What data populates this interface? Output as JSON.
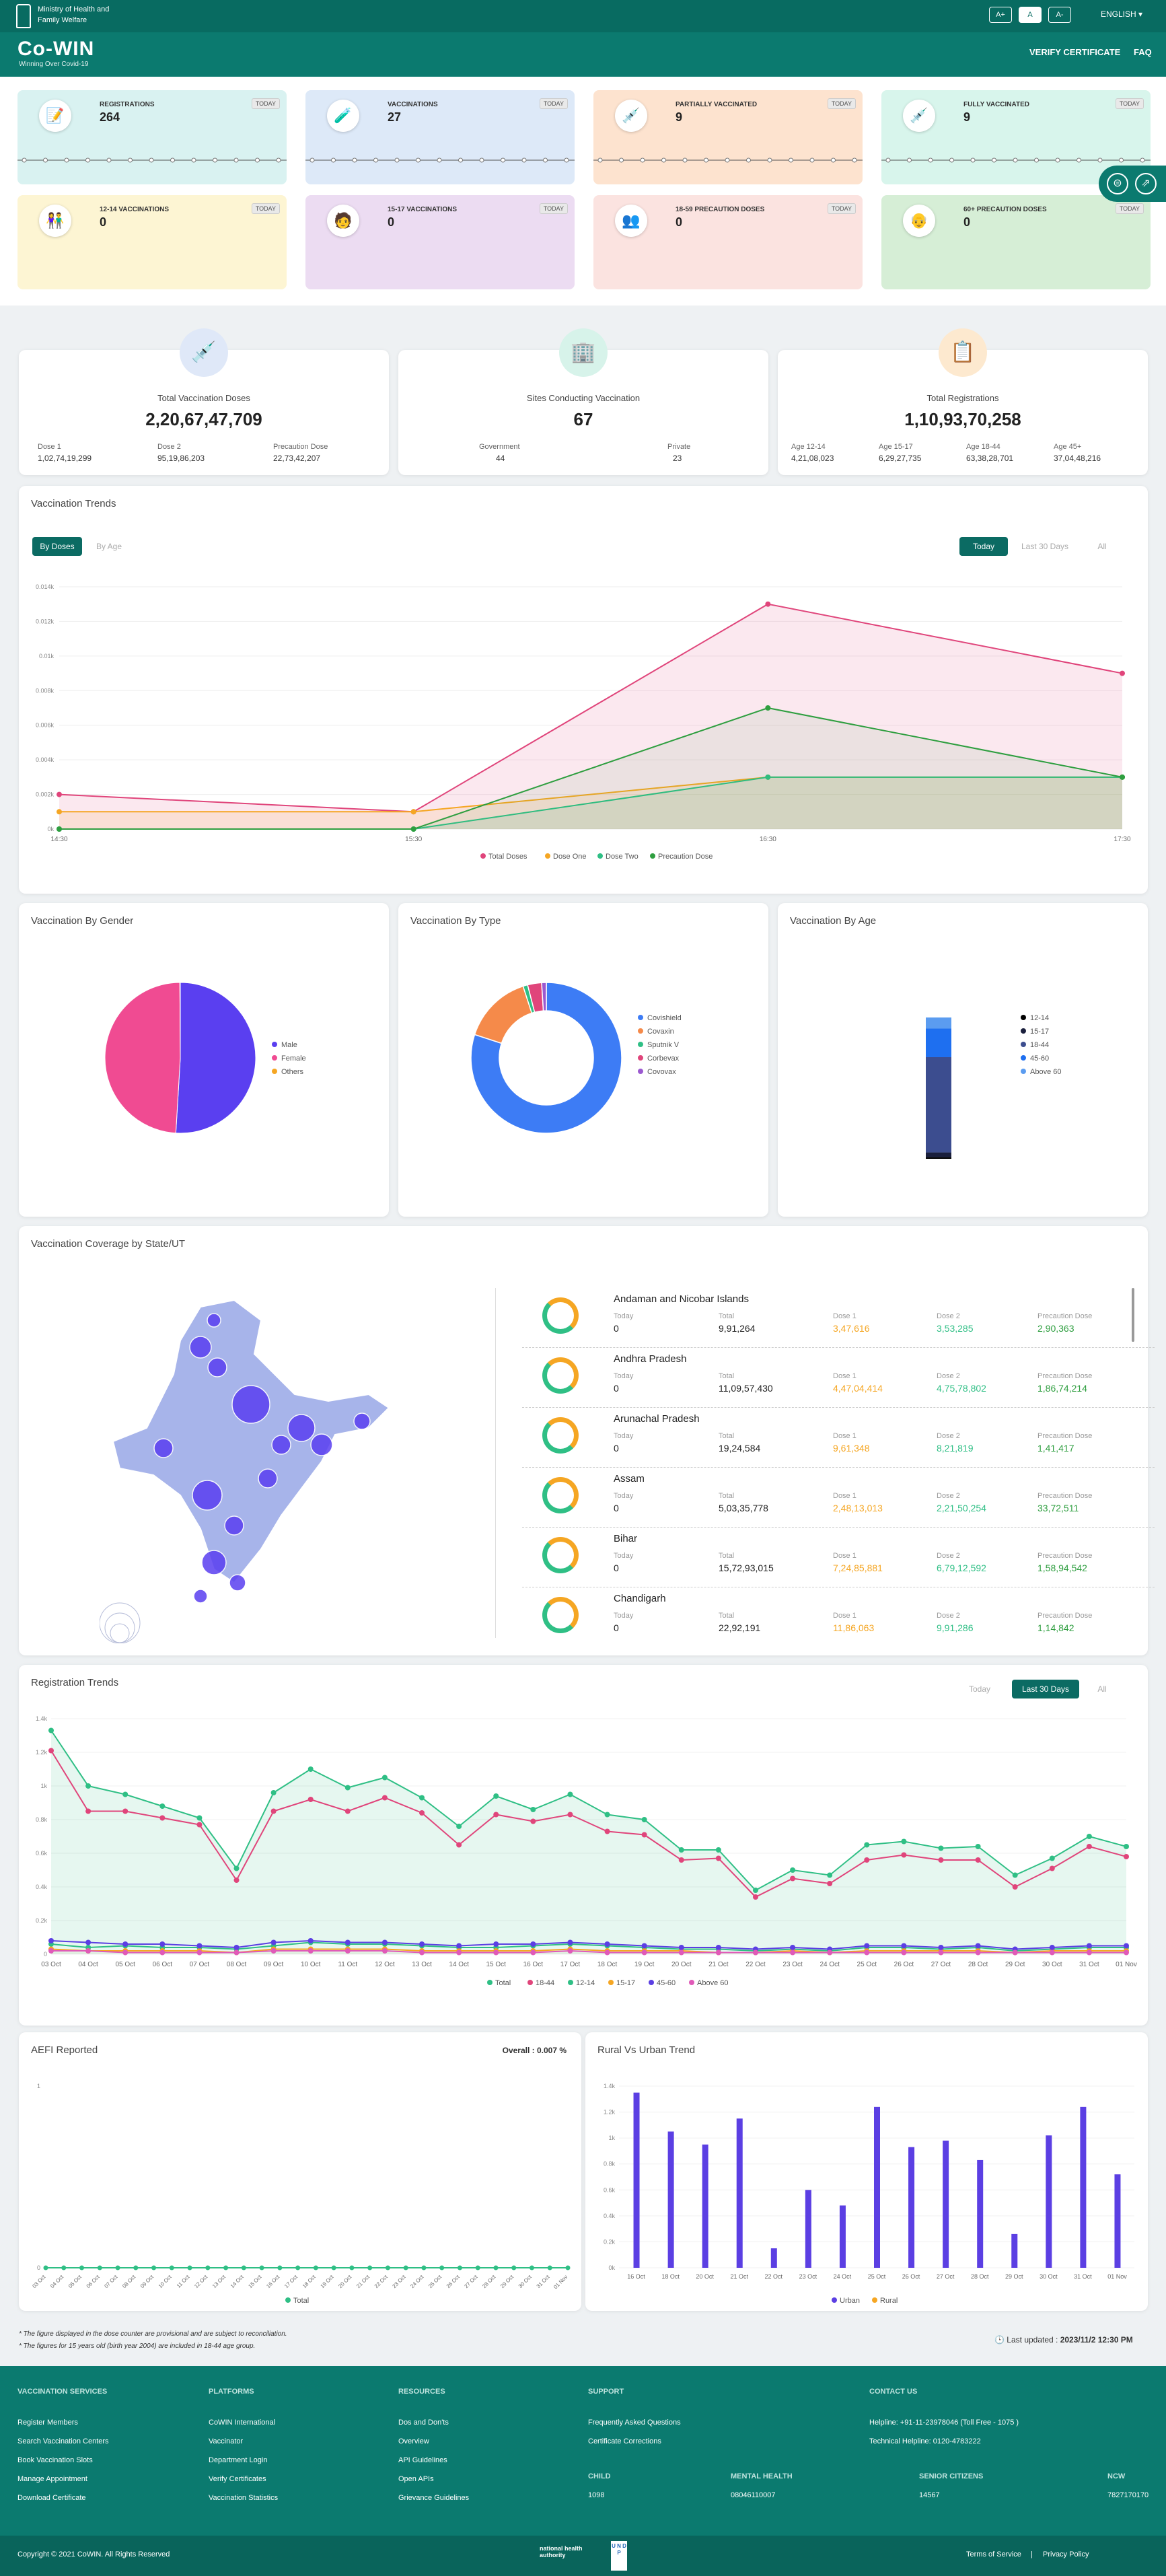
{
  "header": {
    "ministry": "Ministry of Health and Family Welfare",
    "font_buttons": [
      "A+",
      "A",
      "A-"
    ],
    "language": "ENGLISH",
    "logo": "Co-WIN",
    "tagline": "Winning Over Covid-19",
    "nav": [
      "VERIFY CERTIFICATE",
      "FAQ"
    ]
  },
  "today_cards": [
    {
      "label": "REGISTRATIONS",
      "value": "264",
      "badge": "TODAY",
      "bg": "#d9f2f1",
      "icon": "registration-icon"
    },
    {
      "label": "VACCINATIONS",
      "value": "27",
      "badge": "TODAY",
      "bg": "#dde9f8",
      "icon": "vaccine-vial-icon"
    },
    {
      "label": "PARTIALLY VACCINATED",
      "value": "9",
      "badge": "TODAY",
      "bg": "#fde3cf",
      "icon": "partial-vaccinated-icon"
    },
    {
      "label": "FULLY VACCINATED",
      "value": "9",
      "badge": "TODAY",
      "bg": "#d8f5ec",
      "icon": "fully-vaccinated-icon"
    },
    {
      "label": "12-14 VACCINATIONS",
      "value": "0",
      "badge": "TODAY",
      "bg": "#fdf5d3",
      "icon": "children-icon"
    },
    {
      "label": "15-17 VACCINATIONS",
      "value": "0",
      "badge": "TODAY",
      "bg": "#ecdcf2",
      "icon": "teen-icon"
    },
    {
      "label": "18-59 PRECAUTION DOSES",
      "value": "0",
      "badge": "TODAY",
      "bg": "#fbe3e0",
      "icon": "adult-icon"
    },
    {
      "label": "60+ PRECAUTION DOSES",
      "value": "0",
      "badge": "TODAY",
      "bg": "#d6eed6",
      "icon": "senior-icon"
    }
  ],
  "totals": {
    "doses": {
      "title": "Total Vaccination Doses",
      "value": "2,20,67,47,709",
      "subs": [
        {
          "label": "Dose 1",
          "value": "1,02,74,19,299"
        },
        {
          "label": "Dose 2",
          "value": "95,19,86,203"
        },
        {
          "label": "Precaution Dose",
          "value": "22,73,42,207"
        }
      ]
    },
    "sites": {
      "title": "Sites Conducting Vaccination",
      "value": "67",
      "subs": [
        {
          "label": "Government",
          "value": "44"
        },
        {
          "label": "Private",
          "value": "23"
        }
      ]
    },
    "registrations": {
      "title": "Total Registrations",
      "value": "1,10,93,70,258",
      "subs": [
        {
          "label": "Age 12-14",
          "value": "4,21,08,023"
        },
        {
          "label": "Age 15-17",
          "value": "6,29,27,735"
        },
        {
          "label": "Age 18-44",
          "value": "63,38,28,701"
        },
        {
          "label": "Age 45+",
          "value": "37,04,48,216"
        }
      ]
    }
  },
  "trends": {
    "title": "Vaccination Trends",
    "tabs": [
      "By Doses",
      "By Age"
    ],
    "time_tabs": [
      "Today",
      "Last 30 Days",
      "All"
    ]
  },
  "chart_data": [
    {
      "type": "area",
      "categories": [
        "14:30",
        "15:30",
        "16:30",
        "17:30"
      ],
      "y_ticks": [
        "0k",
        "0.002k",
        "0.004k",
        "0.006k",
        "0.008k",
        "0.01k",
        "0.012k",
        "0.014k"
      ],
      "ylim": [
        0,
        14
      ],
      "series": [
        {
          "name": "Total Doses",
          "values": [
            2,
            1,
            13,
            9
          ]
        },
        {
          "name": "Dose One",
          "values": [
            1,
            1,
            3,
            3
          ]
        },
        {
          "name": "Dose Two",
          "values": [
            0,
            0,
            3,
            3
          ]
        },
        {
          "name": "Precaution Dose",
          "values": [
            0,
            0,
            7,
            3
          ]
        }
      ]
    },
    {
      "type": "pie",
      "title": "Vaccination By Gender",
      "labels": [
        "Male",
        "Female",
        "Others"
      ],
      "values": [
        51,
        49,
        0.1
      ]
    },
    {
      "type": "pie",
      "title": "Vaccination By Type",
      "labels": [
        "Covishield",
        "Covaxin",
        "Sputnik V",
        "Corbevax",
        "Covovax"
      ],
      "values": [
        80,
        15,
        1,
        3,
        1
      ]
    },
    {
      "type": "bar",
      "title": "Vaccination By Age",
      "labels": [
        "12-14",
        "15-17",
        "18-44",
        "45-60",
        "Above 60"
      ],
      "values": [
        1,
        3,
        60,
        18,
        7
      ]
    },
    {
      "type": "area",
      "title": "Registration Trends",
      "categories": [
        "03 Oct",
        "04 Oct",
        "05 Oct",
        "06 Oct",
        "07 Oct",
        "08 Oct",
        "09 Oct",
        "10 Oct",
        "11 Oct",
        "12 Oct",
        "13 Oct",
        "14 Oct",
        "15 Oct",
        "16 Oct",
        "17 Oct",
        "18 Oct",
        "19 Oct",
        "20 Oct",
        "21 Oct",
        "22 Oct",
        "23 Oct",
        "24 Oct",
        "25 Oct",
        "26 Oct",
        "27 Oct",
        "28 Oct",
        "29 Oct",
        "30 Oct",
        "31 Oct",
        "01 Nov"
      ],
      "y_ticks": [
        "0",
        "0.2k",
        "0.4k",
        "0.6k",
        "0.8k",
        "1k",
        "1.2k",
        "1.4k"
      ],
      "ylim": [
        0,
        1400
      ],
      "series": [
        {
          "name": "Total",
          "values": [
            1330,
            1000,
            950,
            880,
            810,
            510,
            960,
            1100,
            990,
            1050,
            930,
            760,
            940,
            860,
            950,
            830,
            800,
            620,
            620,
            380,
            500,
            470,
            650,
            670,
            630,
            640,
            470,
            570,
            700,
            640
          ]
        },
        {
          "name": "18-44",
          "values": [
            1210,
            850,
            850,
            810,
            770,
            440,
            850,
            920,
            850,
            930,
            840,
            650,
            830,
            790,
            830,
            730,
            710,
            560,
            570,
            340,
            450,
            420,
            560,
            590,
            560,
            560,
            400,
            510,
            640,
            580
          ]
        },
        {
          "name": "12-14",
          "values": [
            60,
            40,
            50,
            40,
            40,
            30,
            50,
            70,
            60,
            60,
            50,
            40,
            40,
            50,
            60,
            50,
            40,
            30,
            30,
            20,
            30,
            20,
            40,
            40,
            30,
            40,
            20,
            30,
            40,
            40
          ]
        },
        {
          "name": "15-17",
          "values": [
            30,
            20,
            20,
            20,
            20,
            10,
            30,
            30,
            30,
            30,
            20,
            20,
            20,
            20,
            30,
            20,
            20,
            20,
            10,
            10,
            20,
            10,
            20,
            20,
            20,
            20,
            10,
            20,
            20,
            20
          ]
        },
        {
          "name": "45-60",
          "values": [
            80,
            70,
            60,
            60,
            50,
            40,
            70,
            80,
            70,
            70,
            60,
            50,
            60,
            60,
            70,
            60,
            50,
            40,
            40,
            30,
            40,
            30,
            50,
            50,
            40,
            50,
            30,
            40,
            50,
            50
          ]
        },
        {
          "name": "Above 60",
          "values": [
            20,
            20,
            10,
            10,
            10,
            10,
            20,
            20,
            20,
            20,
            10,
            10,
            10,
            10,
            20,
            10,
            10,
            10,
            10,
            10,
            10,
            10,
            10,
            10,
            10,
            10,
            10,
            10,
            10,
            10
          ]
        }
      ]
    },
    {
      "type": "line",
      "title": "AEFI Reported",
      "categories": [
        "03 Oct",
        "04 Oct",
        "05 Oct",
        "06 Oct",
        "07 Oct",
        "08 Oct",
        "09 Oct",
        "10 Oct",
        "11 Oct",
        "12 Oct",
        "13 Oct",
        "14 Oct",
        "15 Oct",
        "16 Oct",
        "17 Oct",
        "18 Oct",
        "19 Oct",
        "20 Oct",
        "21 Oct",
        "22 Oct",
        "23 Oct",
        "24 Oct",
        "25 Oct",
        "26 Oct",
        "27 Oct",
        "28 Oct",
        "29 Oct",
        "30 Oct",
        "31 Oct",
        "01 Nov"
      ],
      "y_ticks": [
        "0",
        "1"
      ],
      "series": [
        {
          "name": "Total",
          "values": [
            0,
            0,
            0,
            0,
            0,
            0,
            0,
            0,
            0,
            0,
            0,
            0,
            0,
            0,
            0,
            0,
            0,
            0,
            0,
            0,
            0,
            0,
            0,
            0,
            0,
            0,
            0,
            0,
            0,
            0
          ]
        }
      ]
    },
    {
      "type": "bar",
      "title": "Rural Vs Urban Trend",
      "categories": [
        "16 Oct",
        "18 Oct",
        "20 Oct",
        "21 Oct",
        "22 Oct",
        "23 Oct",
        "24 Oct",
        "25 Oct",
        "26 Oct",
        "27 Oct",
        "28 Oct",
        "29 Oct",
        "30 Oct",
        "31 Oct",
        "01 Nov"
      ],
      "y_ticks": [
        "0k",
        "0.2k",
        "0.4k",
        "0.6k",
        "0.8k",
        "1k",
        "1.2k",
        "1.4k"
      ],
      "series": [
        {
          "name": "Urban",
          "values": [
            1.35,
            1.05,
            0.95,
            1.15,
            0.15,
            0.6,
            0.48,
            1.24,
            0.93,
            0.98,
            0.83,
            0.26,
            1.02,
            1.24,
            0.72
          ]
        },
        {
          "name": "Rural",
          "values": [
            0,
            0,
            0,
            0,
            0,
            0,
            0,
            0,
            0,
            0,
            0,
            0,
            0,
            0,
            0
          ]
        }
      ]
    }
  ],
  "coverage": {
    "title": "Vaccination Coverage by State/UT",
    "headers": [
      "Today",
      "Total",
      "Dose 1",
      "Dose 2",
      "Precaution Dose"
    ],
    "states": [
      {
        "name": "Andaman and Nicobar Islands",
        "today": "0",
        "total": "9,91,264",
        "d1": "3,47,616",
        "d2": "3,53,285",
        "p": "2,90,363"
      },
      {
        "name": "Andhra Pradesh",
        "today": "0",
        "total": "11,09,57,430",
        "d1": "4,47,04,414",
        "d2": "4,75,78,802",
        "p": "1,86,74,214"
      },
      {
        "name": "Arunachal Pradesh",
        "today": "0",
        "total": "19,24,584",
        "d1": "9,61,348",
        "d2": "8,21,819",
        "p": "1,41,417"
      },
      {
        "name": "Assam",
        "today": "0",
        "total": "5,03,35,778",
        "d1": "2,48,13,013",
        "d2": "2,21,50,254",
        "p": "33,72,511"
      },
      {
        "name": "Bihar",
        "today": "0",
        "total": "15,72,93,015",
        "d1": "7,24,85,881",
        "d2": "6,79,12,592",
        "p": "1,58,94,542"
      },
      {
        "name": "Chandigarh",
        "today": "0",
        "total": "22,92,191",
        "d1": "11,86,063",
        "d2": "9,91,286",
        "p": "1,14,842"
      }
    ]
  },
  "aefi": {
    "overall": "Overall : 0.007 %"
  },
  "notes": [
    "The figure displayed in the dose counter are provisional and are subject to reconciliation.",
    "The figures for 15 years old (birth year 2004) are included in 18-44 age group."
  ],
  "last_updated": {
    "label": "Last updated :",
    "value": "2023/11/2 12:30 PM"
  },
  "footer": {
    "cols": [
      {
        "title": "VACCINATION SERVICES",
        "links": [
          "Register Members",
          "Search Vaccination Centers",
          "Book Vaccination Slots",
          "Manage Appointment",
          "Download Certificate"
        ]
      },
      {
        "title": "PLATFORMS",
        "links": [
          "CoWIN International",
          "Vaccinator",
          "Department Login",
          "Verify Certificates",
          "Vaccination Statistics"
        ]
      },
      {
        "title": "RESOURCES",
        "links": [
          "Dos and Don'ts",
          "Overview",
          "API Guidelines",
          "Open APIs",
          "Grievance Guidelines"
        ]
      },
      {
        "title": "SUPPORT",
        "links": [
          "Frequently Asked Questions",
          "Certificate Corrections"
        ]
      },
      {
        "title": "CONTACT US",
        "links": [
          "Helpline: +91-11-23978046 (Toll Free - 1075 )",
          "Technical Helpline: 0120-4783222"
        ]
      }
    ],
    "helplines": [
      {
        "title": "CHILD",
        "value": "1098"
      },
      {
        "title": "MENTAL HEALTH",
        "value": "08046110007"
      },
      {
        "title": "SENIOR CITIZENS",
        "value": "14567"
      },
      {
        "title": "NCW",
        "value": "7827170170"
      }
    ],
    "copyright": "Copyright © 2021 CoWIN. All Rights Reserved",
    "nha": "national health authority",
    "undp": "U N D P",
    "legal": [
      "Terms of Service",
      "Privacy Policy"
    ]
  },
  "colors": {
    "primary": "#0b7a6f",
    "total": "#e0457b",
    "dose1": "#f5a623",
    "dose2": "#2fbf85",
    "precaution": "#2e9e3f",
    "male": "#5a3ff0",
    "female": "#f04b92",
    "covishield": "#3d7cf5",
    "covaxin": "#f58a4a",
    "bar": "#5b3fe3"
  }
}
